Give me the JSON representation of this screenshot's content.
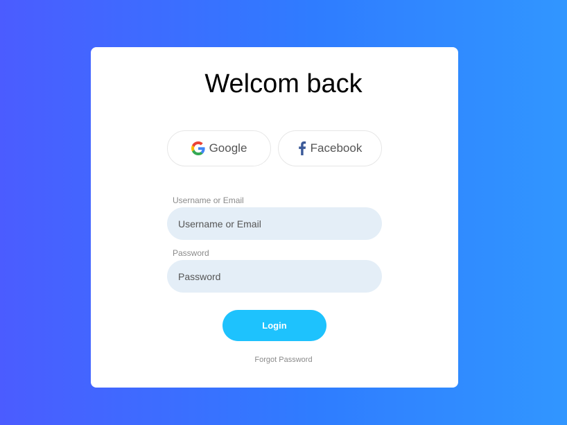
{
  "title": "Welcom back",
  "social": {
    "google_label": "Google",
    "facebook_label": "Facebook",
    "google_icon": "google-g-icon",
    "facebook_icon": "facebook-f-icon"
  },
  "form": {
    "username_label": "Username or Email",
    "username_placeholder": "Username or Email",
    "password_label": "Password",
    "password_placeholder": "Password",
    "login_label": "Login",
    "forgot_label": "Forgot Password"
  },
  "colors": {
    "background_start": "#4b5cff",
    "background_end": "#3196ff",
    "login_button": "#1ec2fd",
    "input_background": "#e4eef7",
    "facebook_blue": "#3b5998"
  }
}
